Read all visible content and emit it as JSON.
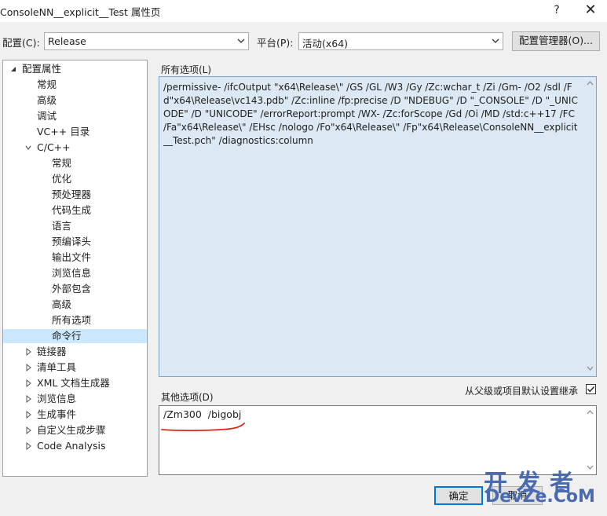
{
  "window": {
    "title": "ConsoleNN__explicit__Test 属性页",
    "help_glyph": "?",
    "close_glyph": "✕"
  },
  "toolbar": {
    "config_label": "配置(C):",
    "config_value": "Release",
    "platform_label": "平台(P):",
    "platform_value": "活动(x64)",
    "config_manager_label": "配置管理器(O)..."
  },
  "tree": {
    "items": [
      {
        "label": "配置属性",
        "expander": "expanded"
      },
      {
        "label": "常规"
      },
      {
        "label": "高级"
      },
      {
        "label": "调试"
      },
      {
        "label": "VC++ 目录"
      },
      {
        "label": "C/C++",
        "expander": "expanded-open"
      },
      {
        "label": "常规"
      },
      {
        "label": "优化"
      },
      {
        "label": "预处理器"
      },
      {
        "label": "代码生成"
      },
      {
        "label": "语言"
      },
      {
        "label": "预编译头"
      },
      {
        "label": "输出文件"
      },
      {
        "label": "浏览信息"
      },
      {
        "label": "外部包含"
      },
      {
        "label": "高级"
      },
      {
        "label": "所有选项"
      },
      {
        "label": "命令行",
        "selected": true
      },
      {
        "label": "链接器",
        "expander": "collapsed"
      },
      {
        "label": "清单工具",
        "expander": "collapsed"
      },
      {
        "label": "XML 文档生成器",
        "expander": "collapsed"
      },
      {
        "label": "浏览信息",
        "expander": "collapsed"
      },
      {
        "label": "生成事件",
        "expander": "collapsed"
      },
      {
        "label": "自定义生成步骤",
        "expander": "collapsed"
      },
      {
        "label": "Code Analysis",
        "expander": "collapsed"
      }
    ]
  },
  "main": {
    "all_options_label": "所有选项(L)",
    "all_options_text": "/permissive- /ifcOutput \"x64\\Release\\\" /GS /GL /W3 /Gy /Zc:wchar_t /Zi /Gm- /O2 /sdl /Fd\"x64\\Release\\vc143.pdb\" /Zc:inline /fp:precise /D \"NDEBUG\" /D \"_CONSOLE\" /D \"_UNICODE\" /D \"UNICODE\" /errorReport:prompt /WX- /Zc:forScope /Gd /Oi /MD /std:c++17 /FC /Fa\"x64\\Release\\\" /EHsc /nologo /Fo\"x64\\Release\\\" /Fp\"x64\\Release\\ConsoleNN__explicit__Test.pch\" /diagnostics:column",
    "other_options_label": "其他选项(D)",
    "other_options_value": "/Zm300  /bigobj",
    "inherit_label": "从父级或项目默认设置继承",
    "inherit_checked": true
  },
  "footer": {
    "ok_label": "确定",
    "cancel_label": "取消"
  },
  "watermark": {
    "cn": "开发者",
    "en": "DevZe.CoM"
  },
  "colors": {
    "selection": "#cce8ff",
    "annotation_underline": "#e8201a",
    "watermark": "#4a6ab0"
  }
}
